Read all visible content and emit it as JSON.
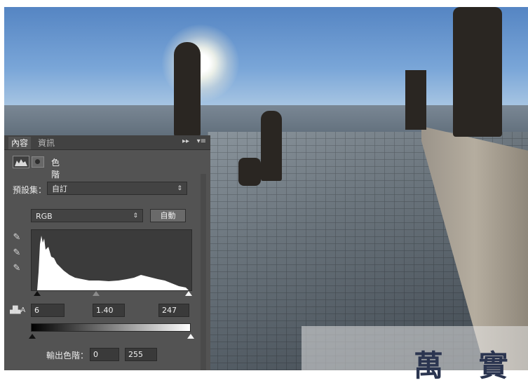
{
  "panel": {
    "tabs": [
      {
        "label": "內容",
        "active": true
      },
      {
        "label": "資訊",
        "active": false
      }
    ],
    "collapse_glyph": "▸▸",
    "menu_glyph": "▾≡",
    "title": "色階",
    "icons": {
      "levels": "levels-adjustment-icon",
      "mask": "layer-mask-icon"
    },
    "preset": {
      "label": "預設集：",
      "value": "自訂"
    },
    "channel": {
      "value": "RGB"
    },
    "auto_label": "自動",
    "eyedroppers": [
      "black-point-eyedropper-icon",
      "gray-point-eyedropper-icon",
      "white-point-eyedropper-icon"
    ],
    "input_levels": {
      "black": "6",
      "gamma": "1.40",
      "white": "247"
    },
    "output_levels": {
      "label": "輸出色階：",
      "black": "0",
      "white": "255"
    }
  },
  "watermark": {
    "text": "萬 實"
  },
  "colors": {
    "panel_bg": "#535353",
    "tab_bar": "#424242",
    "field_bg": "#3a3a3a"
  }
}
